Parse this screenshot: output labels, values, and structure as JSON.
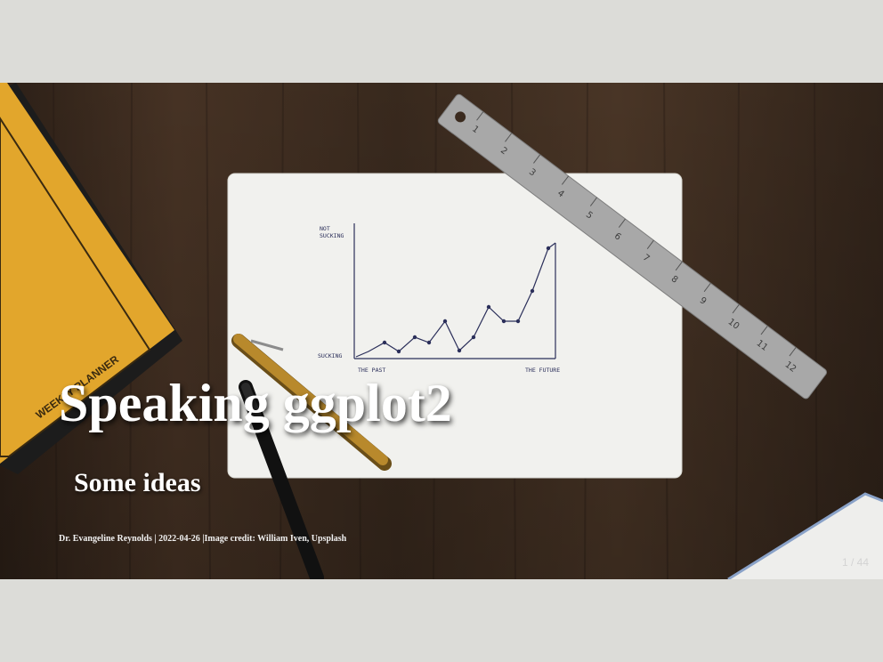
{
  "slide": {
    "title": "Speaking ggplot2",
    "subtitle": "Some ideas",
    "credit": "Dr. Evangeline Reynolds | 2022-04-26 |Image credit: William Iven, Upsplash",
    "slide_number": "1 / 44"
  },
  "background": {
    "notepad_plot": {
      "y_top_label_line1": "NOT",
      "y_top_label_line2": "SUCKING",
      "y_bottom_label": "SUCKING",
      "x_left_label": "THE PAST",
      "x_right_label": "THE FUTURE"
    },
    "ruler_numbers": [
      "1",
      "2",
      "3",
      "4",
      "5",
      "6",
      "7",
      "8",
      "9",
      "10",
      "11",
      "12"
    ],
    "book_text": "WEEKLY PLANNER"
  },
  "colors": {
    "wood": "#3a2a1e",
    "book": "#e0a52a",
    "paper": "#f2f2ef",
    "ruler": "#a6a6a6",
    "pen_gold": "#b0852a",
    "ink": "#2b2f5a"
  }
}
